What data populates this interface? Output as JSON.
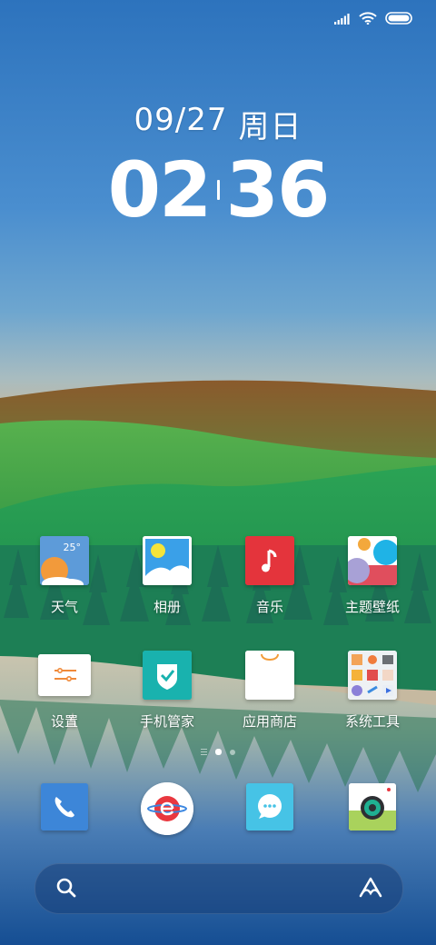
{
  "status_bar": {
    "signal_icon": "signal-bars-icon",
    "wifi_icon": "wifi-icon",
    "battery_icon": "battery-icon",
    "battery_level": 1.0
  },
  "clock": {
    "date": "09/27",
    "weekday": "周日",
    "hours": "02",
    "minutes": "36"
  },
  "apps_row1": [
    {
      "label": "天气",
      "icon": "weather-icon",
      "temperature": "25°"
    },
    {
      "label": "相册",
      "icon": "gallery-icon"
    },
    {
      "label": "音乐",
      "icon": "music-icon"
    },
    {
      "label": "主题壁纸",
      "icon": "themes-icon"
    }
  ],
  "apps_row2": [
    {
      "label": "设置",
      "icon": "settings-icon"
    },
    {
      "label": "手机管家",
      "icon": "security-icon"
    },
    {
      "label": "应用商店",
      "icon": "app-store-icon"
    },
    {
      "label": "系统工具",
      "icon": "system-tools-folder-icon"
    }
  ],
  "page_indicator": {
    "pages": 2,
    "current": 1
  },
  "dock": [
    {
      "icon": "phone-icon"
    },
    {
      "icon": "browser-icon"
    },
    {
      "icon": "messages-icon"
    },
    {
      "icon": "camera-icon"
    }
  ],
  "search": {
    "placeholder": "",
    "search_icon": "search-icon",
    "assistant_icon": "assistant-icon"
  },
  "colors": {
    "music_red": "#e4343c",
    "security_teal": "#19b2ae",
    "phone_blue": "#3d86d8",
    "messages_cyan": "#46c3e6",
    "weather_blue": "#5d9bd9",
    "camera_green": "#a9d25c"
  }
}
